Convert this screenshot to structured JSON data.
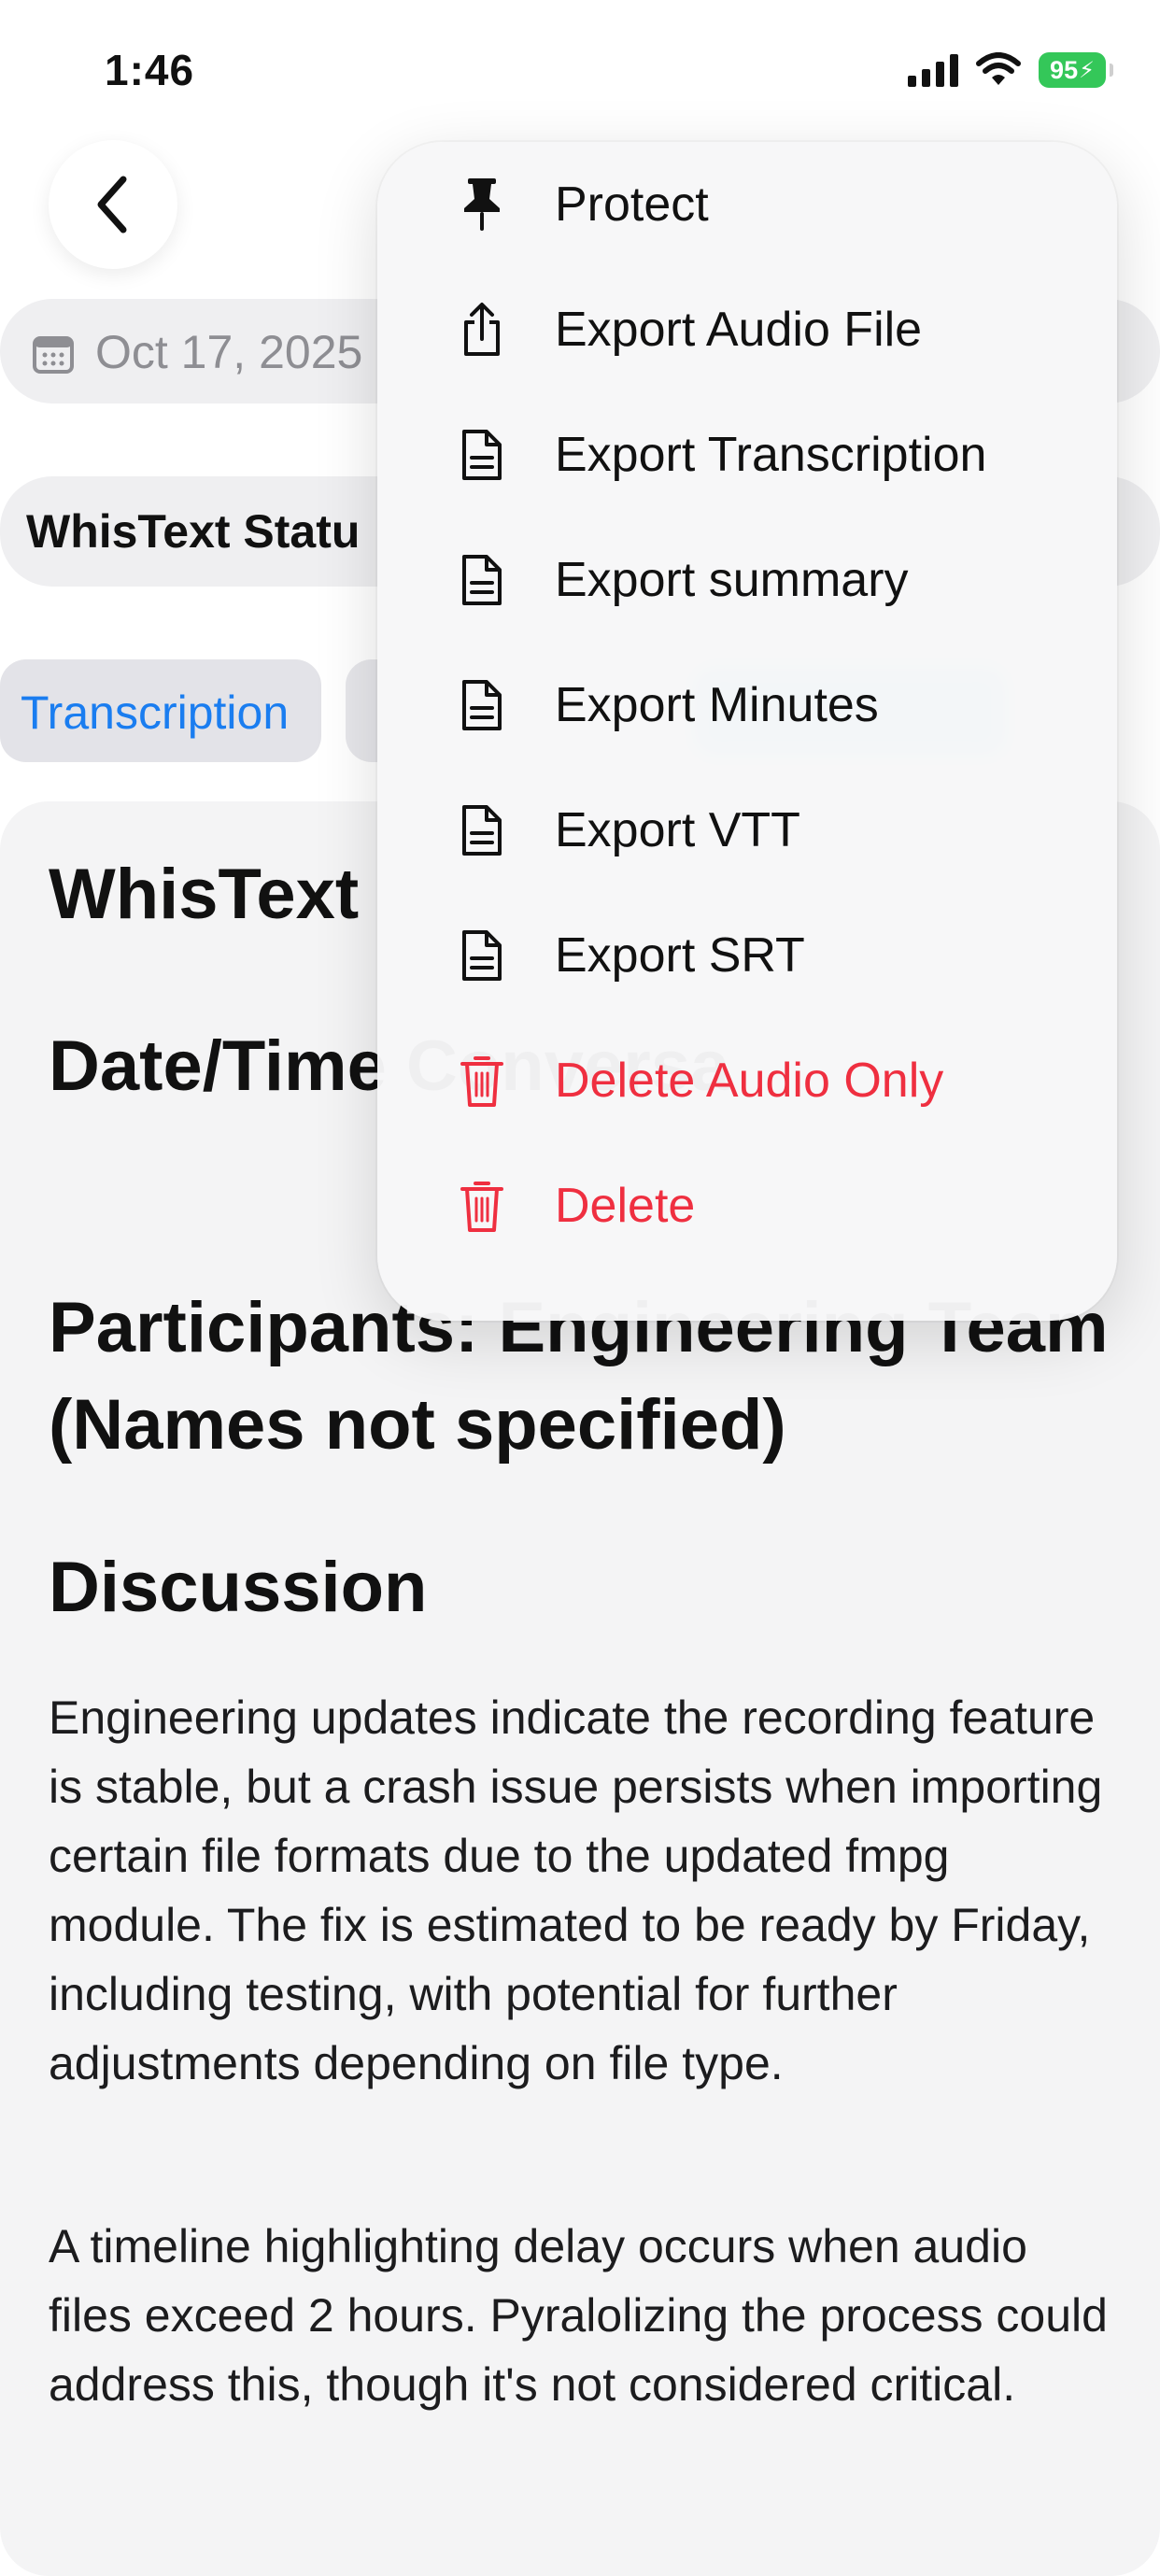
{
  "status_bar": {
    "time": "1:46",
    "battery": "95"
  },
  "header": {
    "date": "Oct 17, 2025",
    "title": "WhisText Statu"
  },
  "tabs": [
    {
      "label": "Transcription"
    }
  ],
  "content": {
    "heading_main": "WhisText",
    "heading_date": "Date/Time Conversa",
    "heading_participants": "Participants: Engineering Team (Names not specified)",
    "heading_discussion": "Discussion",
    "paragraphs": [
      "Engineering updates indicate the recording feature is stable, but a crash issue persists when importing certain file formats due to the updated fmpg module. The fix is estimated to be ready by Friday, including testing, with potential for further adjustments depending on file type.",
      "A timeline highlighting delay occurs when audio files exceed 2 hours. Pyralolizing the process could address this, though it's not considered critical."
    ]
  },
  "menu": {
    "items": [
      {
        "label": "Protect",
        "icon": "pin-icon"
      },
      {
        "label": "Export Audio File",
        "icon": "share-icon"
      },
      {
        "label": "Export Transcription",
        "icon": "document-icon"
      },
      {
        "label": "Export summary",
        "icon": "document-icon"
      },
      {
        "label": "Export Minutes",
        "icon": "document-icon"
      },
      {
        "label": "Export VTT",
        "icon": "document-icon"
      },
      {
        "label": "Export SRT",
        "icon": "document-icon"
      },
      {
        "label": "Delete Audio Only",
        "icon": "trash-icon"
      },
      {
        "label": "Delete",
        "icon": "trash-icon"
      }
    ]
  },
  "colors": {
    "accent": "#1a7df0",
    "danger": "#ef2f40",
    "battery": "#34c759"
  }
}
